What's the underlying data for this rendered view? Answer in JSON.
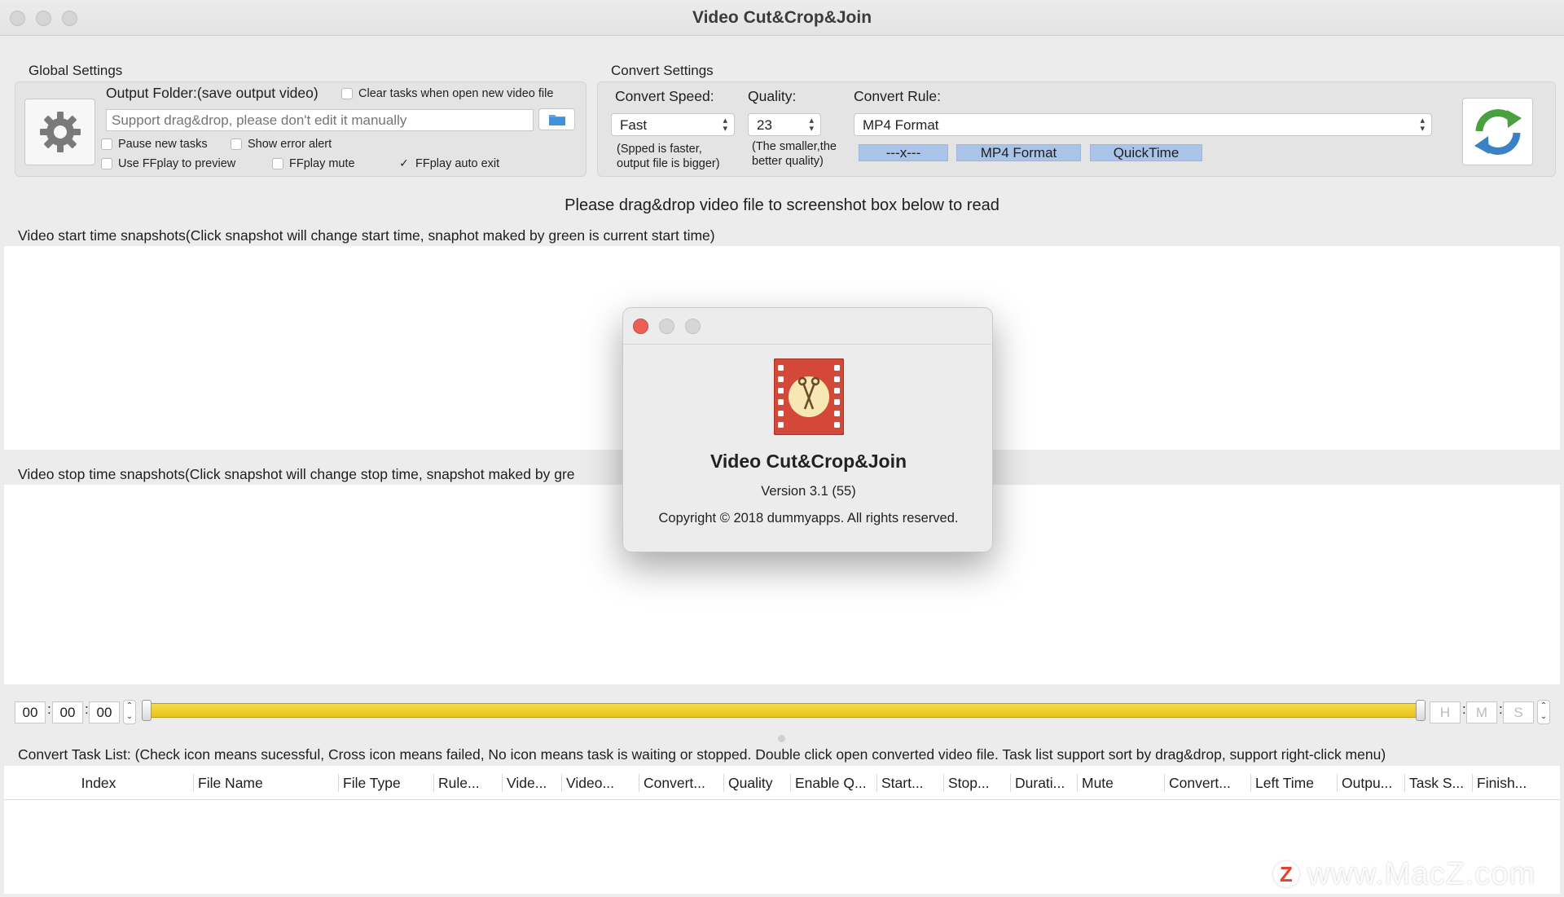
{
  "window": {
    "title": "Video Cut&Crop&Join"
  },
  "global_settings": {
    "label": "Global Settings",
    "output_folder_label": "Output Folder:(save output video)",
    "clear_tasks_label": "Clear tasks when open new video file",
    "clear_tasks_checked": false,
    "folder_placeholder": "Support drag&drop, please don't edit it manually",
    "folder_value": "",
    "pause_new_tasks_label": "Pause new tasks",
    "pause_new_tasks_checked": false,
    "show_error_alert_label": "Show error alert",
    "show_error_alert_checked": false,
    "use_ffplay_label": "Use FFplay to preview",
    "use_ffplay_checked": false,
    "ffplay_mute_label": "FFplay mute",
    "ffplay_mute_checked": false,
    "ffplay_auto_exit_label": "FFplay auto exit",
    "ffplay_auto_exit_checked": true
  },
  "convert_settings": {
    "label": "Convert Settings",
    "speed_label": "Convert Speed:",
    "speed_value": "Fast",
    "speed_hint_line1": "(Spped is faster,",
    "speed_hint_line2": "output file is bigger)",
    "quality_label": "Quality:",
    "quality_value": "23",
    "quality_hint_line1": "(The smaller,the",
    "quality_hint_line2": "better quality)",
    "rule_label": "Convert Rule:",
    "rule_value": "MP4 Format",
    "rule_chips": [
      "---x---",
      "MP4 Format",
      "QuickTime"
    ]
  },
  "main": {
    "drop_message": "Please drag&drop video file to screenshot box below to read",
    "start_snapshots_label": "Video start time snapshots(Click snapshot will change start time, snaphot maked by green is current start time)",
    "stop_snapshots_label": "Video stop time snapshots(Click snapshot will change stop time, snapshot maked by gre"
  },
  "timeline": {
    "start_h": "00",
    "start_m": "00",
    "start_s": "00",
    "end_h_placeholder": "H",
    "end_m_placeholder": "M",
    "end_s_placeholder": "S",
    "colon": ":",
    "stepper_up": "⌃",
    "stepper_down": "⌄"
  },
  "task_list": {
    "label": "Convert Task List: (Check icon means sucessful,  Cross icon means failed, No icon means task is waiting or stopped. Double click open converted video file. Task list support sort by drag&drop, support right-click menu)",
    "columns": [
      "Index",
      "File Name",
      "File Type",
      "Rule...",
      "Vide...",
      "Video...",
      "Convert...",
      "Quality",
      "Enable Q...",
      "Start...",
      "Stop...",
      "Durati...",
      "Mute",
      "Convert...",
      "Left Time",
      "Outpu...",
      "Task S...",
      "Finish..."
    ]
  },
  "about_dialog": {
    "app_name": "Video Cut&Crop&Join",
    "version": "Version 3.1 (55)",
    "copyright": "Copyright © 2018 dummyapps. All rights reserved."
  },
  "watermark": {
    "icon_letter": "Z",
    "text": "www.MacZ.com"
  },
  "colors": {
    "accent_chip": "#a9c4e8",
    "slider": "#f0d43a",
    "close_red": "#ec5f56",
    "icon_red": "#d4483a"
  }
}
